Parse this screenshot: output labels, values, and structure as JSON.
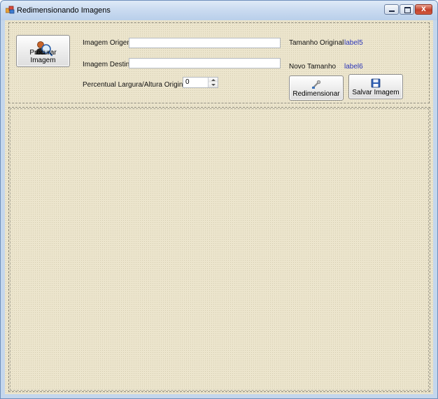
{
  "window": {
    "title": "Redimensionando Imagens",
    "close_glyph": "x"
  },
  "form": {
    "browse_button": "Procurar Imagem",
    "source_label": "Imagem Origem",
    "source_value": "",
    "dest_label": "Imagem Destino",
    "dest_value": "",
    "percent_label": "Percentual  Largura/Altura Original",
    "percent_value": "0",
    "original_size_label": "Tamanho Original",
    "original_size_value": "label5",
    "new_size_label": "Novo Tamanho",
    "new_size_value": "label6",
    "resize_button": "Redimensionar",
    "save_button": "Salvar Imagem"
  },
  "icons": {
    "app": "app-icon",
    "browse": "user-search-icon",
    "resize": "resize-tool-icon",
    "save": "floppy-disk-icon"
  },
  "colors": {
    "panel_bg": "#ece5cd",
    "value_label": "#2b35b8",
    "titlebar": "#c9daf0"
  }
}
